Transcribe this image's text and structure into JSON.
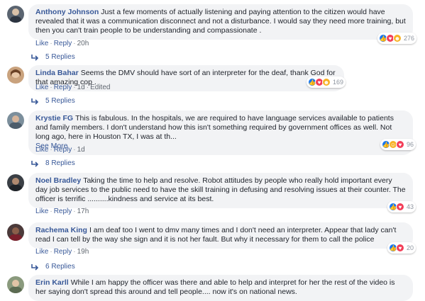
{
  "comments": [
    {
      "name": "Anthony Johnson",
      "text": "Just a few moments of actually listening and paying attention to the citizen would have revealed that it was a communication disconnect and not a disturbance. I would say they need more training, but then you can't train people to be understanding and compassionate .",
      "like": "Like",
      "reply": "Reply",
      "time": "20h",
      "edited": "",
      "see_more": "",
      "reactions": [
        "like",
        "love",
        "sad"
      ],
      "reaction_count": "276",
      "replies": "5 Replies",
      "avatar_color": "#5a6470"
    },
    {
      "name": "Linda Bahar",
      "text": "Seems the DMV should have sort of an interpreter for the deaf, thank God for that amazing cop .",
      "like": "Like",
      "reply": "Reply",
      "time": "1d",
      "edited": "Edited",
      "see_more": "",
      "reactions": [
        "like",
        "love",
        "wow"
      ],
      "reaction_count": "169",
      "replies": "5 Replies",
      "avatar_color": "#c9a27d"
    },
    {
      "name": "Krystie FG",
      "text": "This is fabulous. In the hospitals, we are required to have language services available to patients and family members. I don't understand how this isn't something required by government offices as well. Not long ago, here in Houston TX, I was at th...",
      "like": "Like",
      "reply": "Reply",
      "time": "1d",
      "edited": "",
      "see_more": "See More",
      "reactions": [
        "like",
        "haha",
        "love"
      ],
      "reaction_count": "96",
      "replies": "8 Replies",
      "avatar_color": "#7c8f9c"
    },
    {
      "name": "Noel Bradley",
      "text": "Taking the time to help and resolve. Robot attitudes by people who really hold important every day job services to the public need to have the skill training in defusing and resolving issues at their counter. The officer is terrific ..........kindness and service at its best.",
      "like": "Like",
      "reply": "Reply",
      "time": "17h",
      "edited": "",
      "see_more": "",
      "reactions": [
        "like",
        "love"
      ],
      "reaction_count": "43",
      "replies": "",
      "avatar_color": "#3a3f45"
    },
    {
      "name": "Rachema King",
      "text": "I am deaf too I went to dmv many times and I don't need an interpreter. Appear that lady can't read I can tell by the way she sign and it is not her fault. But why it necessary for them to call the police",
      "like": "Like",
      "reply": "Reply",
      "time": "19h",
      "edited": "",
      "see_more": "",
      "reactions": [
        "like",
        "love"
      ],
      "reaction_count": "20",
      "replies": "6 Replies",
      "avatar_color": "#4b3a3a"
    },
    {
      "name": "Erin Karll",
      "text": "While I am happy the officer was there and able to help and interpret for her the rest of the video is her saying don't spread this around and tell people.... now it's on national news.",
      "like": "",
      "reply": "",
      "time": "",
      "edited": "",
      "see_more": "",
      "reactions": [],
      "reaction_count": "",
      "replies": "",
      "avatar_color": "#8a9a7d"
    }
  ],
  "theme": {
    "link": "#385898",
    "bubble": "#f2f3f5",
    "like_blue": "#1877f2",
    "love_red": "#f33e58",
    "emoji_yellow": "#f7b125"
  }
}
